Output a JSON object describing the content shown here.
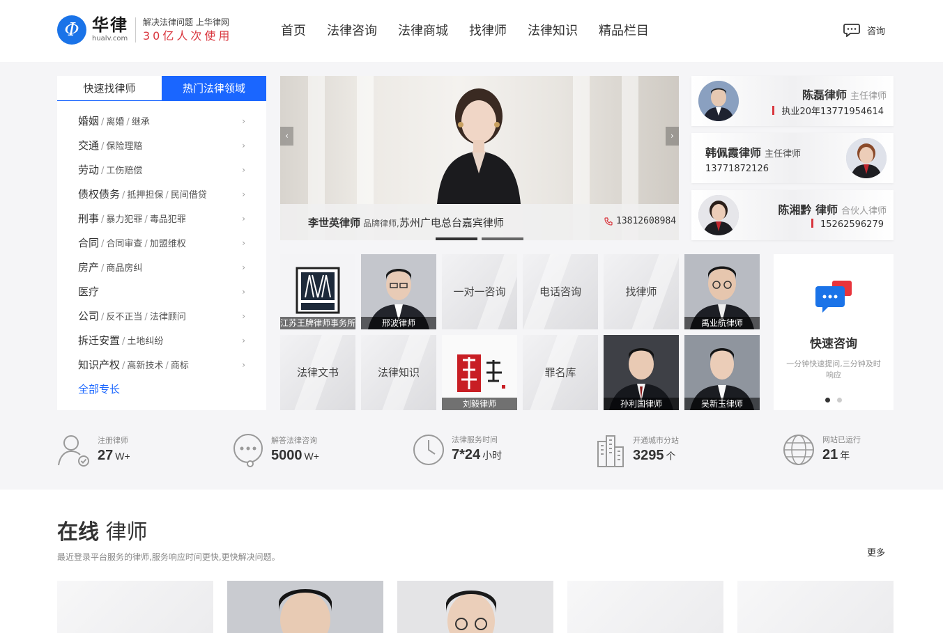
{
  "header": {
    "logo_mark": "Φ",
    "logo_cn": "华律",
    "logo_en": "hualv.com",
    "slogan_line1": "解决法律问题 上华律网",
    "slogan_line2": "30亿人次使用",
    "nav": [
      "首页",
      "法律咨询",
      "法律商城",
      "找律师",
      "法律知识",
      "精品栏目"
    ],
    "consult_label": "咨询"
  },
  "category_panel": {
    "tabs": [
      "快速找律师",
      "热门法律领域"
    ],
    "active_tab": 1,
    "items": [
      {
        "main": "婚姻",
        "subs": [
          "离婚",
          "继承"
        ]
      },
      {
        "main": "交通",
        "subs": [
          "保险理赔"
        ]
      },
      {
        "main": "劳动",
        "subs": [
          "工伤赔偿"
        ]
      },
      {
        "main": "债权债务",
        "subs": [
          "抵押担保",
          "民间借贷"
        ]
      },
      {
        "main": "刑事",
        "subs": [
          "暴力犯罪",
          "毒品犯罪"
        ]
      },
      {
        "main": "合同",
        "subs": [
          "合同审查",
          "加盟维权"
        ]
      },
      {
        "main": "房产",
        "subs": [
          "商品房纠"
        ]
      },
      {
        "main": "医疗",
        "subs": []
      },
      {
        "main": "公司",
        "subs": [
          "反不正当",
          "法律顾问"
        ]
      },
      {
        "main": "拆迁安置",
        "subs": [
          "土地纠纷"
        ]
      },
      {
        "main": "知识产权",
        "subs": [
          "高新技术",
          "商标"
        ]
      }
    ],
    "all_label": "全部专长"
  },
  "banner": {
    "name": "李世英律师",
    "title": "品牌律师,",
    "desc": "苏州广电总台嘉宾律师",
    "phone": "13812608984",
    "prev_icon": "‹",
    "next_icon": "›"
  },
  "side_lawyers": [
    {
      "name": "陈磊律师",
      "title": "主任律师",
      "info": "执业20年13771954614"
    },
    {
      "name": "韩佩霞律师",
      "title": "主任律师",
      "info": "13771872126"
    },
    {
      "name": "陈湘黔 律师",
      "title": "合伙人律师",
      "info": "15262596279"
    }
  ],
  "tiles_row1": [
    {
      "label": "",
      "caption": "江苏王牌律师事务所",
      "logo_text": "王牌律师"
    },
    {
      "label": "",
      "caption": "邢波律师"
    },
    {
      "label": "一对一咨询",
      "caption": ""
    },
    {
      "label": "电话咨询",
      "caption": ""
    },
    {
      "label": "找律师",
      "caption": ""
    },
    {
      "label": "",
      "caption": "禹业航律师"
    }
  ],
  "tiles_row2": [
    {
      "label": "法律文书",
      "caption": ""
    },
    {
      "label": "法律知识",
      "caption": ""
    },
    {
      "label": "",
      "caption": "刘毅律师",
      "logo_text": "律新"
    },
    {
      "label": "罪名库",
      "caption": ""
    },
    {
      "label": "",
      "caption": "孙利国律师"
    },
    {
      "label": "",
      "caption": "吴新玉律师"
    }
  ],
  "quick_consult": {
    "title": "快速咨询",
    "desc": "一分钟快速提问,三分钟及时响应"
  },
  "stats": [
    {
      "label": "注册律师",
      "value": "27",
      "unit": "W+",
      "icon": "lawyer-icon"
    },
    {
      "label": "解答法律咨询",
      "value": "5000",
      "unit": "W+",
      "icon": "chat-bubble-icon"
    },
    {
      "label": "法律服务时间",
      "value": "7*24",
      "unit": "小时",
      "icon": "clock-icon"
    },
    {
      "label": "开通城市分站",
      "value": "3295",
      "unit": "个",
      "icon": "city-icon"
    },
    {
      "label": "网站已运行",
      "value": "21",
      "unit": "年",
      "icon": "globe-icon"
    }
  ],
  "online": {
    "title_bold": "在线",
    "title_rest": "律师",
    "subtitle": "最近登录平台服务的律师,服务响应时间更快,更快解决问题。",
    "more": "更多"
  },
  "colors": {
    "brand_blue": "#1a66ff",
    "accent_red": "#d9363e"
  }
}
